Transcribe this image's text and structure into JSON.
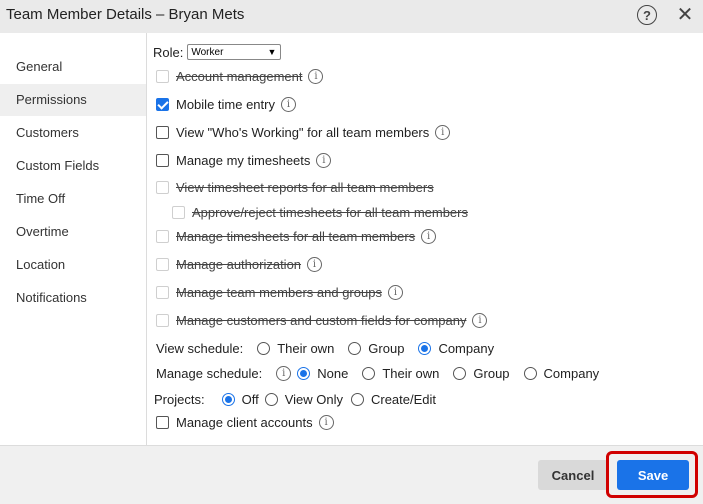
{
  "dialog": {
    "title": "Team Member Details – Bryan Mets",
    "help_glyph": "?",
    "close_glyph": "✕"
  },
  "sidebar": {
    "items": [
      {
        "label": "General"
      },
      {
        "label": "Permissions",
        "active": true
      },
      {
        "label": "Customers"
      },
      {
        "label": "Custom Fields"
      },
      {
        "label": "Time Off"
      },
      {
        "label": "Overtime"
      },
      {
        "label": "Location"
      },
      {
        "label": "Notifications"
      }
    ]
  },
  "permissions": {
    "role_label": "Role:",
    "role_value": "Worker",
    "items": [
      {
        "label": "Account management",
        "checked": false,
        "disabled": true,
        "info": true
      },
      {
        "label": "Mobile time entry",
        "checked": true,
        "disabled": false,
        "info": true
      },
      {
        "label": "View \"Who's Working\" for all team members",
        "checked": false,
        "disabled": false,
        "info": true
      },
      {
        "label": "Manage my timesheets",
        "checked": false,
        "disabled": false,
        "info": true
      },
      {
        "label": "View timesheet reports for all team members",
        "checked": false,
        "disabled": true,
        "info": false
      },
      {
        "label": "Approve/reject timesheets for all team members",
        "checked": false,
        "disabled": true,
        "info": false
      },
      {
        "label": "Manage timesheets for all team members",
        "checked": false,
        "disabled": true,
        "info": true
      },
      {
        "label": "Manage authorization",
        "checked": false,
        "disabled": true,
        "info": true
      },
      {
        "label": "Manage team members and groups",
        "checked": false,
        "disabled": true,
        "info": true
      },
      {
        "label": "Manage customers and custom fields for company",
        "checked": false,
        "disabled": true,
        "info": true
      }
    ],
    "view_schedule": {
      "label": "View schedule:",
      "options": [
        "Their own",
        "Group",
        "Company"
      ],
      "selected": "Company"
    },
    "manage_schedule": {
      "label": "Manage schedule:",
      "options": [
        "None",
        "Their own",
        "Group",
        "Company"
      ],
      "selected": "None"
    },
    "projects": {
      "label": "Projects:",
      "options": [
        "Off",
        "View Only",
        "Create/Edit"
      ],
      "selected": "Off"
    },
    "manage_client_accounts": {
      "label": "Manage client accounts",
      "checked": false
    }
  },
  "footer": {
    "cancel_label": "Cancel",
    "save_label": "Save"
  },
  "colors": {
    "accent": "#1a73e8",
    "highlight": "#d00000"
  }
}
